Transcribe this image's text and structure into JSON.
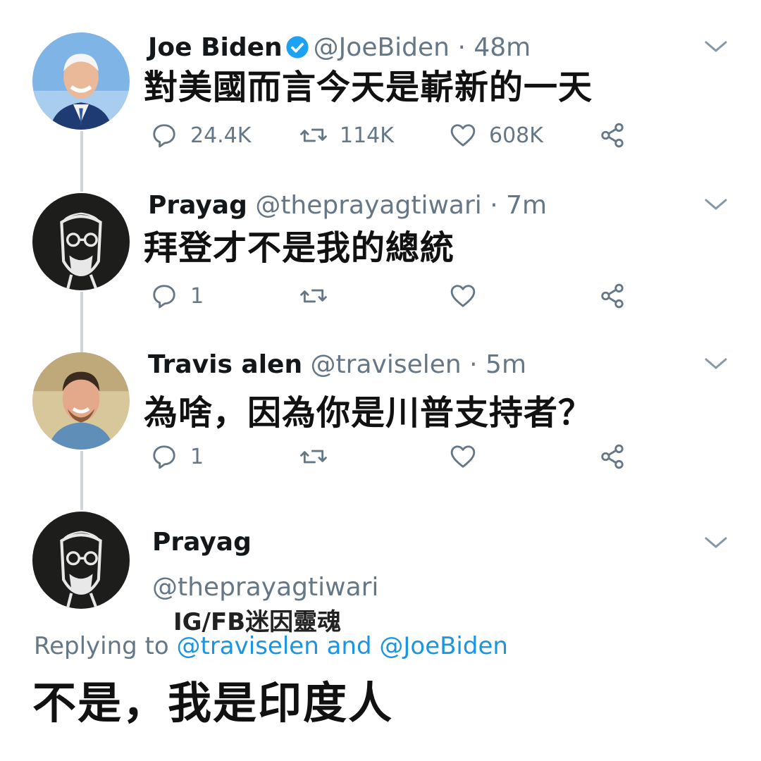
{
  "tweets": [
    {
      "name": "Joe Biden",
      "handle": "@JoeBiden",
      "time": "· 48m",
      "verified": true,
      "text": "對美國而言今天是嶄新的一天",
      "replies": "24.4K",
      "retweets": "114K",
      "likes": "608K"
    },
    {
      "name": "Prayag",
      "handle": "@theprayagtiwari",
      "time": "· 7m",
      "verified": false,
      "text": "拜登才不是我的總統",
      "replies": "1",
      "retweets": "",
      "likes": ""
    },
    {
      "name": "Travis alen",
      "handle": "@traviselen",
      "time": "· 5m",
      "verified": false,
      "text": "為啥，因為你是川普支持者？",
      "replies": "1",
      "retweets": "",
      "likes": ""
    }
  ],
  "final_tweet": {
    "name": "Prayag",
    "handle": "@theprayagtiwari",
    "replying_prefix": "Replying to ",
    "replying_user1": "@traviselen",
    "replying_and": " and ",
    "replying_user2": "@JoeBiden",
    "text": "不是，我是印度人"
  },
  "watermark": "IG/FB迷因靈魂",
  "icons": {
    "reply": "reply-icon",
    "retweet": "retweet-icon",
    "like": "heart-icon",
    "share": "share-icon",
    "chevron": "chevron-down-icon",
    "verified": "verified-badge-icon"
  },
  "colors": {
    "muted": "#657786",
    "link": "#1b95e0",
    "verified": "#1da1f2",
    "thread_line": "#cfd5da"
  }
}
